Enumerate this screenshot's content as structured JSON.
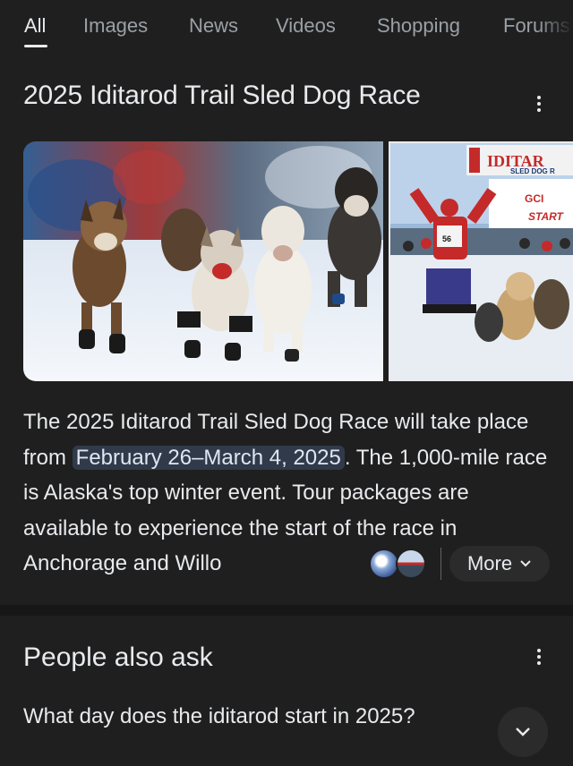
{
  "tabs": [
    "All",
    "Images",
    "News",
    "Videos",
    "Shopping",
    "Forums"
  ],
  "knowledge_panel": {
    "title": "2025 Iditarod Trail Sled Dog Race",
    "images": {
      "main": "sled-dogs-running",
      "side": {
        "banner_text": "IDITAR",
        "banner_sub": "SLED DOG R",
        "sponsor_text": "GCI",
        "start_text": "START",
        "bib_number": "56"
      }
    },
    "description": {
      "before": "The 2025 Iditarod Trail Sled Dog Race will take place from ",
      "highlight": "February 26–March 4, 2025",
      "after": ". The 1,000-mile race is Alaska's top winter event. Tour packages are available to experience the start of the race in Anchorage and Willo"
    },
    "more_label": "More"
  },
  "people_also_ask": {
    "title": "People also ask",
    "question": "What day does the iditarod start in 2025?"
  },
  "colors": {
    "background": "#1f1f1f",
    "text": "#e8eaed",
    "muted": "#9aa0a6",
    "highlight_bg": "#303a4a"
  }
}
